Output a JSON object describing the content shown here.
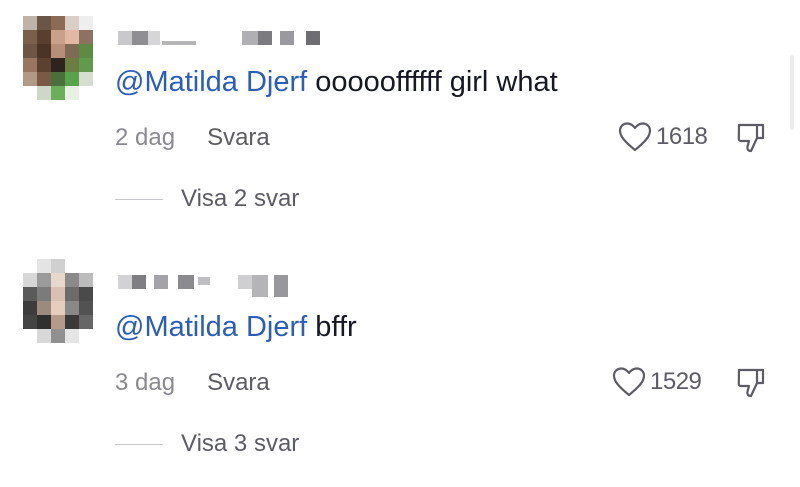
{
  "comments": [
    {
      "mention": "@Matilda Djerf",
      "text": "oooooffffff girl what",
      "date": "2 dag",
      "reply_label": "Svara",
      "likes": "1618",
      "view_replies": "Visa 2 svar"
    },
    {
      "mention": "@Matilda Djerf",
      "text": "bffr",
      "date": "3 dag",
      "reply_label": "Svara",
      "likes": "1529",
      "view_replies": "Visa 3 svar"
    }
  ],
  "colors": {
    "mention": "#2b5db9",
    "text": "#161823",
    "secondary": "#8a8b91"
  },
  "icons": [
    "avatar",
    "heart-icon",
    "thumbs-down-icon"
  ]
}
